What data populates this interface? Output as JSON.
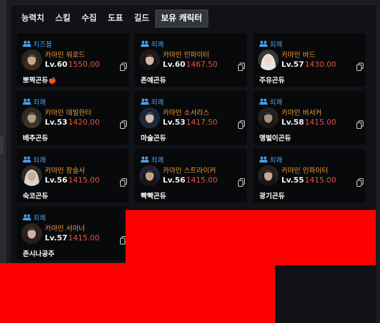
{
  "tabs": [
    "능력치",
    "스킬",
    "수집",
    "도표",
    "길드",
    "보유 캐릭터"
  ],
  "active_tab": "보유 캐릭터",
  "colors": {
    "guild": "#4a9ee6",
    "server_class": "#f09a2e",
    "item_level": "#e2553e"
  },
  "characters": [
    {
      "guild": "치즈볼",
      "server_class": "카마인 워로드",
      "level": "Lv.60",
      "item_level": "1550.00",
      "name": "뽀짝곤듀",
      "emoji": "🍎",
      "avatar_hair": "#3a2a20",
      "avatar_skin": "#c9a58a",
      "avatar_bg": "#2a2620"
    },
    {
      "guild": "죄쾌",
      "server_class": "카마인 인파이터",
      "level": "Lv.60",
      "item_level": "1467.50",
      "name": "존예곤듀",
      "avatar_hair": "#161314",
      "avatar_skin": "#d8b5a2",
      "avatar_bg": "#24191b"
    },
    {
      "guild": "죄쾌",
      "server_class": "카마인 바드",
      "level": "Lv.57",
      "item_level": "1430.00",
      "name": "주유곤듀",
      "avatar_hair": "#e9e6e4",
      "avatar_skin": "#eed8cc",
      "avatar_bg": "#3a3635"
    },
    {
      "guild": "죄쾌",
      "server_class": "카마인 데빌헌터",
      "level": "Lv.53",
      "item_level": "1420.00",
      "name": "배추곤듀",
      "avatar_hair": "#3d3328",
      "avatar_skin": "#b79a80",
      "avatar_bg": "#2b2923"
    },
    {
      "guild": "죄쾌",
      "server_class": "카마인 소서리스",
      "level": "Lv.53",
      "item_level": "1417.50",
      "name": "마술곤듀",
      "avatar_hair": "#1d2a3a",
      "avatar_skin": "#d4b8a8",
      "avatar_bg": "#1b2634"
    },
    {
      "guild": "죄쾌",
      "server_class": "카마인 버서커",
      "level": "Lv.58",
      "item_level": "1415.00",
      "name": "앵벌이곤듀",
      "avatar_hair": "#1a1816",
      "avatar_skin": "#a88f7a",
      "avatar_bg": "#24211e"
    },
    {
      "guild": "죄쾌",
      "server_class": "카마인 창술사",
      "level": "Lv.56",
      "item_level": "1415.00",
      "name": "숙코곤듀",
      "avatar_hair": "#d7d3cf",
      "avatar_skin": "#c6ab96",
      "avatar_bg": "#2c2b2a"
    },
    {
      "guild": "죄쾌",
      "server_class": "카마인 스트라이커",
      "level": "Lv.56",
      "item_level": "1415.00",
      "name": "빡빡곤듀",
      "avatar_hair": "#14161c",
      "avatar_skin": "#c2a28e",
      "avatar_bg": "#1f2230"
    },
    {
      "guild": "죄쾌",
      "server_class": "카마인 인파이터",
      "level": "Lv.55",
      "item_level": "1415.00",
      "name": "광기곤듀",
      "avatar_hair": "#181516",
      "avatar_skin": "#c7a698",
      "avatar_bg": "#2a1f22"
    },
    {
      "guild": "죄쾌",
      "server_class": "카마인 서머너",
      "level": "Lv.57",
      "item_level": "1415.00",
      "name": "존시나공주",
      "avatar_hair": "#2a1e1c",
      "avatar_skin": "#d2b0a0",
      "avatar_bg": "#2b2222"
    }
  ]
}
